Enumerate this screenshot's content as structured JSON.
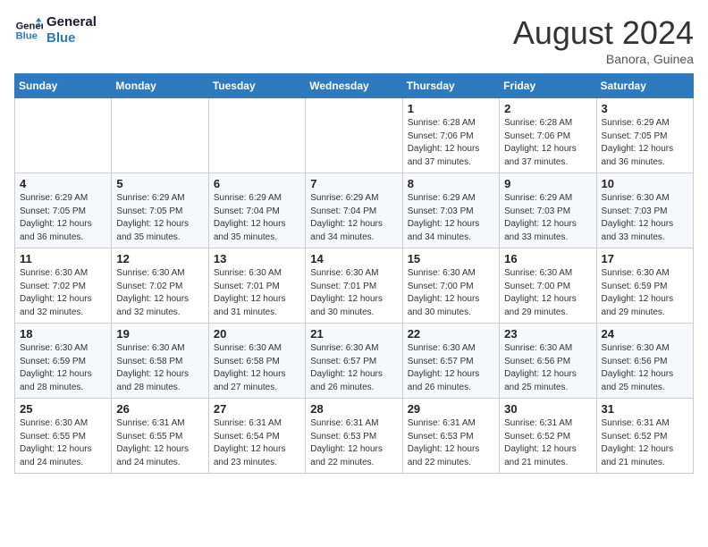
{
  "header": {
    "logo_line1": "General",
    "logo_line2": "Blue",
    "month_year": "August 2024",
    "location": "Banora, Guinea"
  },
  "weekdays": [
    "Sunday",
    "Monday",
    "Tuesday",
    "Wednesday",
    "Thursday",
    "Friday",
    "Saturday"
  ],
  "weeks": [
    [
      {
        "day": "",
        "info": ""
      },
      {
        "day": "",
        "info": ""
      },
      {
        "day": "",
        "info": ""
      },
      {
        "day": "",
        "info": ""
      },
      {
        "day": "1",
        "info": "Sunrise: 6:28 AM\nSunset: 7:06 PM\nDaylight: 12 hours\nand 37 minutes."
      },
      {
        "day": "2",
        "info": "Sunrise: 6:28 AM\nSunset: 7:06 PM\nDaylight: 12 hours\nand 37 minutes."
      },
      {
        "day": "3",
        "info": "Sunrise: 6:29 AM\nSunset: 7:05 PM\nDaylight: 12 hours\nand 36 minutes."
      }
    ],
    [
      {
        "day": "4",
        "info": "Sunrise: 6:29 AM\nSunset: 7:05 PM\nDaylight: 12 hours\nand 36 minutes."
      },
      {
        "day": "5",
        "info": "Sunrise: 6:29 AM\nSunset: 7:05 PM\nDaylight: 12 hours\nand 35 minutes."
      },
      {
        "day": "6",
        "info": "Sunrise: 6:29 AM\nSunset: 7:04 PM\nDaylight: 12 hours\nand 35 minutes."
      },
      {
        "day": "7",
        "info": "Sunrise: 6:29 AM\nSunset: 7:04 PM\nDaylight: 12 hours\nand 34 minutes."
      },
      {
        "day": "8",
        "info": "Sunrise: 6:29 AM\nSunset: 7:03 PM\nDaylight: 12 hours\nand 34 minutes."
      },
      {
        "day": "9",
        "info": "Sunrise: 6:29 AM\nSunset: 7:03 PM\nDaylight: 12 hours\nand 33 minutes."
      },
      {
        "day": "10",
        "info": "Sunrise: 6:30 AM\nSunset: 7:03 PM\nDaylight: 12 hours\nand 33 minutes."
      }
    ],
    [
      {
        "day": "11",
        "info": "Sunrise: 6:30 AM\nSunset: 7:02 PM\nDaylight: 12 hours\nand 32 minutes."
      },
      {
        "day": "12",
        "info": "Sunrise: 6:30 AM\nSunset: 7:02 PM\nDaylight: 12 hours\nand 32 minutes."
      },
      {
        "day": "13",
        "info": "Sunrise: 6:30 AM\nSunset: 7:01 PM\nDaylight: 12 hours\nand 31 minutes."
      },
      {
        "day": "14",
        "info": "Sunrise: 6:30 AM\nSunset: 7:01 PM\nDaylight: 12 hours\nand 30 minutes."
      },
      {
        "day": "15",
        "info": "Sunrise: 6:30 AM\nSunset: 7:00 PM\nDaylight: 12 hours\nand 30 minutes."
      },
      {
        "day": "16",
        "info": "Sunrise: 6:30 AM\nSunset: 7:00 PM\nDaylight: 12 hours\nand 29 minutes."
      },
      {
        "day": "17",
        "info": "Sunrise: 6:30 AM\nSunset: 6:59 PM\nDaylight: 12 hours\nand 29 minutes."
      }
    ],
    [
      {
        "day": "18",
        "info": "Sunrise: 6:30 AM\nSunset: 6:59 PM\nDaylight: 12 hours\nand 28 minutes."
      },
      {
        "day": "19",
        "info": "Sunrise: 6:30 AM\nSunset: 6:58 PM\nDaylight: 12 hours\nand 28 minutes."
      },
      {
        "day": "20",
        "info": "Sunrise: 6:30 AM\nSunset: 6:58 PM\nDaylight: 12 hours\nand 27 minutes."
      },
      {
        "day": "21",
        "info": "Sunrise: 6:30 AM\nSunset: 6:57 PM\nDaylight: 12 hours\nand 26 minutes."
      },
      {
        "day": "22",
        "info": "Sunrise: 6:30 AM\nSunset: 6:57 PM\nDaylight: 12 hours\nand 26 minutes."
      },
      {
        "day": "23",
        "info": "Sunrise: 6:30 AM\nSunset: 6:56 PM\nDaylight: 12 hours\nand 25 minutes."
      },
      {
        "day": "24",
        "info": "Sunrise: 6:30 AM\nSunset: 6:56 PM\nDaylight: 12 hours\nand 25 minutes."
      }
    ],
    [
      {
        "day": "25",
        "info": "Sunrise: 6:30 AM\nSunset: 6:55 PM\nDaylight: 12 hours\nand 24 minutes."
      },
      {
        "day": "26",
        "info": "Sunrise: 6:31 AM\nSunset: 6:55 PM\nDaylight: 12 hours\nand 24 minutes."
      },
      {
        "day": "27",
        "info": "Sunrise: 6:31 AM\nSunset: 6:54 PM\nDaylight: 12 hours\nand 23 minutes."
      },
      {
        "day": "28",
        "info": "Sunrise: 6:31 AM\nSunset: 6:53 PM\nDaylight: 12 hours\nand 22 minutes."
      },
      {
        "day": "29",
        "info": "Sunrise: 6:31 AM\nSunset: 6:53 PM\nDaylight: 12 hours\nand 22 minutes."
      },
      {
        "day": "30",
        "info": "Sunrise: 6:31 AM\nSunset: 6:52 PM\nDaylight: 12 hours\nand 21 minutes."
      },
      {
        "day": "31",
        "info": "Sunrise: 6:31 AM\nSunset: 6:52 PM\nDaylight: 12 hours\nand 21 minutes."
      }
    ]
  ]
}
